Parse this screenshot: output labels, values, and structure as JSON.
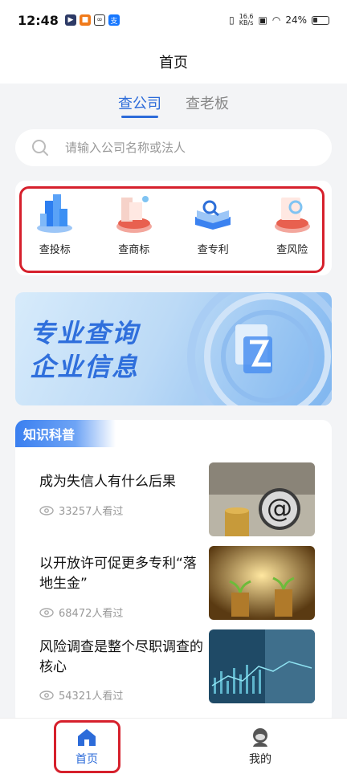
{
  "status_bar": {
    "time": "12:48",
    "speed_value": "16.6",
    "speed_unit": "KB/s",
    "battery": "24%"
  },
  "header": {
    "title": "首页"
  },
  "tabs": [
    {
      "label": "查公司",
      "active": true
    },
    {
      "label": "查老板",
      "active": false
    }
  ],
  "search": {
    "placeholder": "请输入公司名称或法人"
  },
  "quick_actions": [
    {
      "label": "查投标",
      "icon": "bid-icon"
    },
    {
      "label": "查商标",
      "icon": "trademark-icon"
    },
    {
      "label": "查专利",
      "icon": "patent-icon"
    },
    {
      "label": "查风险",
      "icon": "risk-icon"
    }
  ],
  "banner": {
    "line1": "专业查询",
    "line2": "企业信息"
  },
  "knowledge": {
    "title": "知识科普",
    "articles": [
      {
        "title": "成为失信人有什么后果",
        "views": "33257人看过"
      },
      {
        "title": "以开放许可促更多专利“落地生金”",
        "views": "68472人看过"
      },
      {
        "title": "风险调查是整个尽职调查的核心",
        "views": "54321人看过"
      }
    ]
  },
  "bottom_nav": [
    {
      "label": "首页",
      "icon": "home-icon",
      "active": true
    },
    {
      "label": "我的",
      "icon": "profile-icon",
      "active": false
    }
  ],
  "colors": {
    "accent": "#2c6bd9",
    "highlight": "#d6202c"
  }
}
